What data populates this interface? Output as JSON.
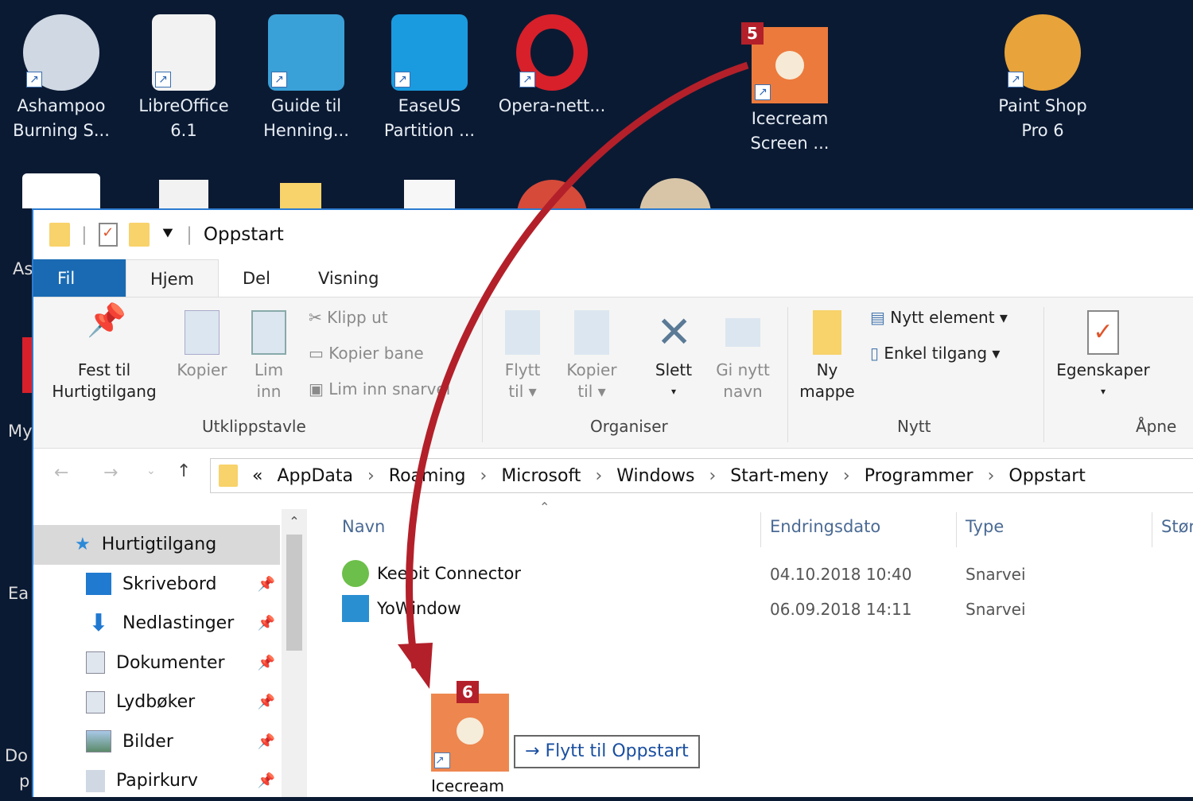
{
  "desktop": {
    "icons": [
      {
        "line1": "Ashampoo",
        "line2": "Burning S...",
        "color": "#cfd8e3"
      },
      {
        "line1": "LibreOffice",
        "line2": "6.1",
        "color": "#f2f2f2"
      },
      {
        "line1": "Guide til",
        "line2": "Henning...",
        "color": "#3aa0d8"
      },
      {
        "line1": "EaseUS",
        "line2": "Partition ...",
        "color": "#1a9be0"
      },
      {
        "line1": "Opera-nett...",
        "line2": "",
        "color": "#d8202a"
      },
      {
        "line1": "Icecream",
        "line2": "Screen ...",
        "color": "#ec7a3c"
      },
      {
        "line1": "Paint Shop",
        "line2": "Pro 6",
        "color": "#e8a33a"
      }
    ],
    "partial_labels": [
      "As",
      "My",
      "Ea",
      "Do",
      "p"
    ],
    "step5": "5",
    "step6": "6"
  },
  "window": {
    "title": "Oppstart",
    "tabs": [
      "Fil",
      "Hjem",
      "Del",
      "Visning"
    ],
    "ribbon": {
      "pin": "Fest til",
      "pin2": "Hurtigtilgang",
      "copy": "Kopier",
      "paste1": "Lim",
      "paste2": "inn",
      "cut": "Klipp ut",
      "copypath": "Kopier bane",
      "pasteshort": "Lim inn snarvei",
      "group1": "Utklippstavle",
      "move1": "Flytt",
      "move2": "til ▾",
      "copyto1": "Kopier",
      "copyto2": "til ▾",
      "delete": "Slett",
      "delete2": "▾",
      "rename1": "Gi nytt",
      "rename2": "navn",
      "group2": "Organiser",
      "newfolder1": "Ny",
      "newfolder2": "mappe",
      "newitem": "Nytt element ▾",
      "easy": "Enkel tilgang ▾",
      "group3": "Nytt",
      "props": "Egenskaper",
      "props2": "▾",
      "group4": "Åpne"
    },
    "path": [
      "«",
      "AppData",
      "›",
      "Roaming",
      "›",
      "Microsoft",
      "›",
      "Windows",
      "›",
      "Start-meny",
      "›",
      "Programmer",
      "›",
      "Oppstart"
    ],
    "nav": [
      {
        "label": "Hurtigtilgang",
        "color": "#2b8ad8"
      },
      {
        "label": "Skrivebord",
        "color": "#1f7ad0"
      },
      {
        "label": "Nedlastinger",
        "color": "#2078d0"
      },
      {
        "label": "Dokumenter",
        "color": "#dfe6ee"
      },
      {
        "label": "Lydbøker",
        "color": "#dfe6ee"
      },
      {
        "label": "Bilder",
        "color": "#5b8a6a"
      },
      {
        "label": "Papirkurv",
        "color": "#cfd8e3"
      }
    ],
    "columns": [
      "Navn",
      "Endringsdato",
      "Type",
      "Stør"
    ],
    "files": [
      {
        "name": "Keepit Connector",
        "date": "04.10.2018 10:40",
        "type": "Snarvei",
        "color": "#6cbf4a"
      },
      {
        "name": "YoWindow",
        "date": "06.09.2018 14:11",
        "type": "Snarvei",
        "color": "#2a8fd0"
      }
    ],
    "drag": {
      "tooltip": "Flytt til Oppstart",
      "label": "Icecream"
    }
  },
  "colors": {
    "arrow": "#b3202a",
    "accent": "#1a6ab3"
  }
}
